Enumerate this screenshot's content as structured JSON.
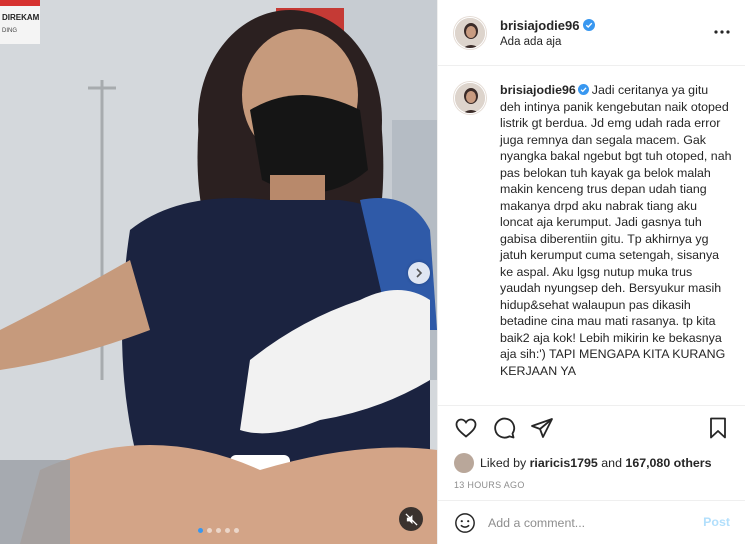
{
  "colors": {
    "accent": "#0095f6",
    "verified": "#3897f0",
    "post_disabled": "#b2dffc",
    "muted": "#8e8e8e"
  },
  "media": {
    "sign_text": "DIREKAM",
    "sign_subtext": "DING",
    "carousel_dots": 5,
    "active_dot": 1,
    "next_icon": "chevron-right-icon",
    "audio_icon": "muted-speaker-icon"
  },
  "header": {
    "username": "brisiajodie96",
    "location": "Ada ada aja",
    "more_icon": "ellipsis-icon"
  },
  "caption": {
    "username": "brisiajodie96",
    "text": "Jadi ceritanya ya gitu deh intinya panik kengebutan naik otoped listrik gt berdua. Jd emg udah rada error juga remnya dan segala macem. Gak nyangka bakal ngebut bgt tuh otoped, nah pas belokan tuh kayak ga belok malah makin kenceng trus depan udah tiang makanya drpd aku nabrak tiang aku loncat aja kerumput. Jadi gasnya tuh gabisa diberentiin gitu. Tp akhirnya yg jatuh kerumput cuma setengah, sisanya ke aspal. Aku lgsg nutup muka trus yaudah nyungsep deh. Bersyukur masih hidup&sehat walaupun pas dikasih betadine cina mau mati rasanya. tp kita baik2 aja kok! Lebih mikirin ke bekasnya aja sih:') TAPI MENGAPA KITA KURANG KERJAAN YA"
  },
  "actions": {
    "like_icon": "heart-icon",
    "comment_icon": "comment-bubble-icon",
    "share_icon": "paper-plane-icon",
    "save_icon": "bookmark-icon"
  },
  "likes": {
    "prefix": "Liked by",
    "user": "riaricis1795",
    "connector": "and",
    "count": "167,080 others"
  },
  "timestamp": "13 HOURS AGO",
  "comment": {
    "placeholder": "Add a comment...",
    "post_label": "Post",
    "emoji_icon": "smiley-icon"
  }
}
